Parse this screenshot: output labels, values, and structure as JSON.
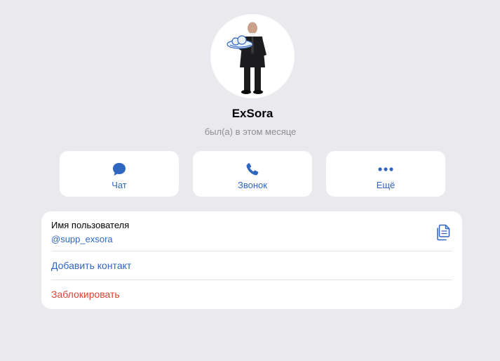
{
  "profile": {
    "name": "ExSora",
    "status": "был(а) в этом месяце"
  },
  "actions": [
    {
      "label": "Чат",
      "icon": "chat-bubble-icon"
    },
    {
      "label": "Звонок",
      "icon": "phone-icon"
    },
    {
      "label": "Ещё",
      "icon": "more-dots-icon"
    }
  ],
  "info": {
    "username_label": "Имя пользователя",
    "username_value": "@supp_exsora",
    "add_contact": "Добавить контакт",
    "block": "Заблокировать"
  },
  "colors": {
    "accent": "#2f66c0",
    "danger": "#e0402f",
    "background": "#e9e9ee"
  }
}
